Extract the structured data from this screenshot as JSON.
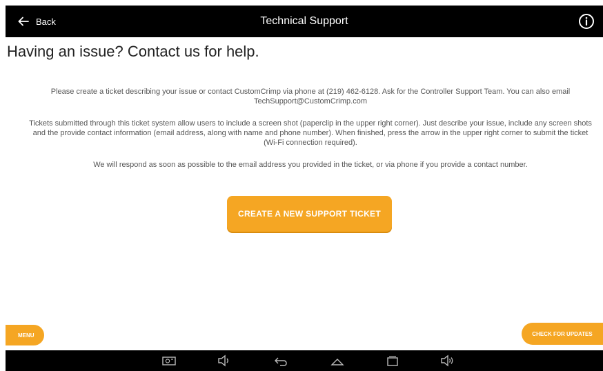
{
  "header": {
    "back_label": "Back",
    "title": "Technical Support",
    "icons": [
      "back-arrow-icon",
      "info-icon"
    ]
  },
  "page": {
    "heading": "Having an issue? Contact us for help.",
    "paragraphs": [
      "Please create a ticket describing your issue or contact CustomCrimp via phone at (219) 462-6128. Ask for the Controller Support Team. You can also email TechSupport@CustomCrimp.com",
      "Tickets submitted through this ticket system allow users to include a screen shot (paperclip in the upper right corner). Just describe your issue, include any screen shots and the provide contact information (email address, along with name and phone number). When finished, press the arrow in the upper right corner to submit the ticket (Wi-Fi connection required).",
      "We will respond as soon as possible to the email address you provided in the ticket, or via phone if you provide a contact number."
    ],
    "cta_label": "CREATE A NEW SUPPORT TICKET"
  },
  "footer": {
    "menu_label": "MENU",
    "updates_label": "CHECK FOR UPDATES"
  },
  "system_nav": {
    "icons": [
      "screenshot-icon",
      "volume-down-icon",
      "back-icon",
      "home-icon",
      "recents-icon",
      "volume-up-icon"
    ]
  },
  "colors": {
    "accent": "#f5a623",
    "bar": "#000000",
    "text": "#555555"
  }
}
